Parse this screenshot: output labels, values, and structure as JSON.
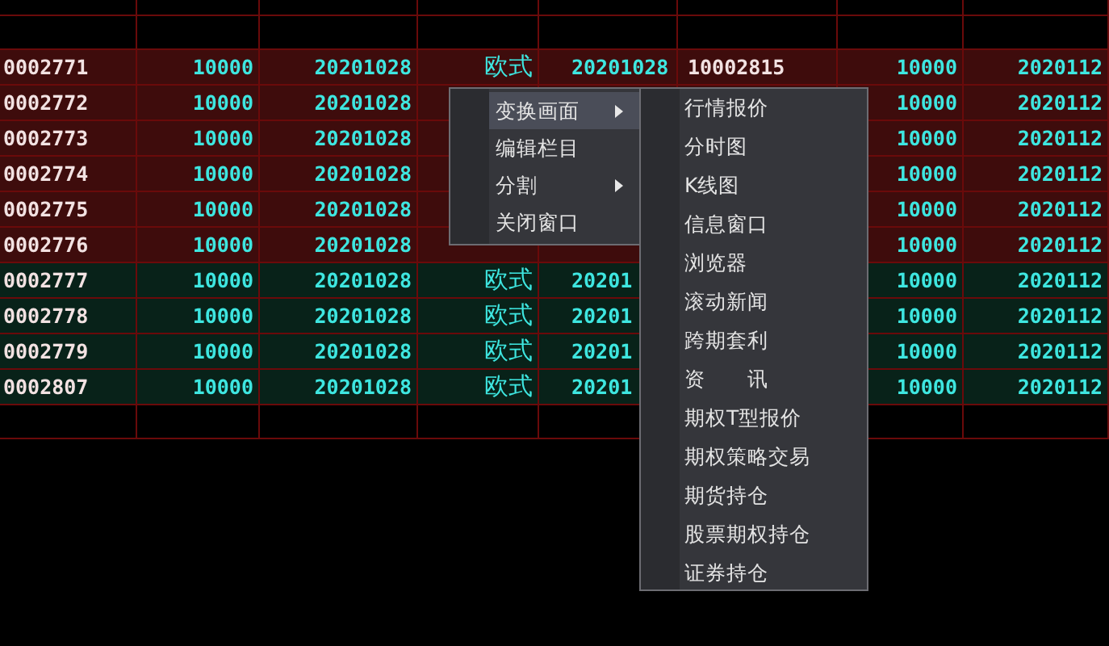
{
  "table": {
    "rows": [
      {
        "color": "#3e0c0c",
        "column_1": "0002771",
        "column_2": "10000",
        "column_3": "20201028",
        "column_4": "欧式",
        "column_5": "20201028",
        "column_6": "10002815",
        "column_7": "10000",
        "column_8": "2020112"
      },
      {
        "color": "#3e0c0c",
        "column_1": "0002772",
        "column_2": "10000",
        "column_3": "20201028",
        "column_7": "10000",
        "column_8": "2020112"
      },
      {
        "color": "#3e0c0c",
        "column_1": "0002773",
        "column_2": "10000",
        "column_3": "20201028",
        "column_7": "10000",
        "column_8": "2020112"
      },
      {
        "color": "#3e0c0c",
        "column_1": "0002774",
        "column_2": "10000",
        "column_3": "20201028",
        "column_7": "10000",
        "column_8": "2020112"
      },
      {
        "color": "#3e0c0c",
        "column_1": "0002775",
        "column_2": "10000",
        "column_3": "20201028",
        "column_7": "10000",
        "column_8": "2020112"
      },
      {
        "color": "#3e0c0c",
        "column_1": "0002776",
        "column_2": "10000",
        "column_3": "20201028",
        "column_7": "10000",
        "column_8": "2020112"
      },
      {
        "color": "#082219",
        "column_1": "0002777",
        "column_2": "10000",
        "column_3": "20201028",
        "column_4": "欧式",
        "column_5": "20201",
        "column_7": "10000",
        "column_8": "2020112"
      },
      {
        "color": "#082219",
        "column_1": "0002778",
        "column_2": "10000",
        "column_3": "20201028",
        "column_4": "欧式",
        "column_5": "20201",
        "column_7": "10000",
        "column_8": "2020112"
      },
      {
        "color": "#082219",
        "column_1": "0002779",
        "column_2": "10000",
        "column_3": "20201028",
        "column_4": "欧式",
        "column_5": "20201",
        "column_7": "10000",
        "column_8": "2020112"
      },
      {
        "color": "#082219",
        "column_1": "0002807",
        "column_2": "10000",
        "column_3": "20201028",
        "column_4": "欧式",
        "column_5": "20201",
        "column_7": "10000",
        "column_8": "2020112"
      }
    ]
  },
  "context_menu": {
    "items": [
      {
        "label": "变换画面",
        "selected": true,
        "has_submenu": true
      },
      {
        "label": "编辑栏目",
        "selected": false,
        "has_submenu": false
      },
      {
        "label": "分割",
        "selected": false,
        "has_submenu": true
      },
      {
        "label": "关闭窗口",
        "selected": false,
        "has_submenu": false
      }
    ]
  },
  "submenu": {
    "items": [
      {
        "label": "行情报价",
        "selected": false
      },
      {
        "label": "分时图",
        "selected": false
      },
      {
        "label": "K线图",
        "selected": false
      },
      {
        "label": "信息窗口",
        "selected": false
      },
      {
        "label": "浏览器",
        "selected": false
      },
      {
        "label": "滚动新闻",
        "selected": false
      },
      {
        "label": "跨期套利",
        "selected": false
      },
      {
        "label": "资　　讯",
        "selected": false
      },
      {
        "label": "期权T型报价",
        "selected": false
      },
      {
        "label": "期权策略交易",
        "selected": false
      },
      {
        "label": "期货持仓",
        "selected": false
      },
      {
        "label": "股票期权持仓",
        "selected": false
      },
      {
        "label": "证券持仓",
        "selected": false
      }
    ]
  }
}
